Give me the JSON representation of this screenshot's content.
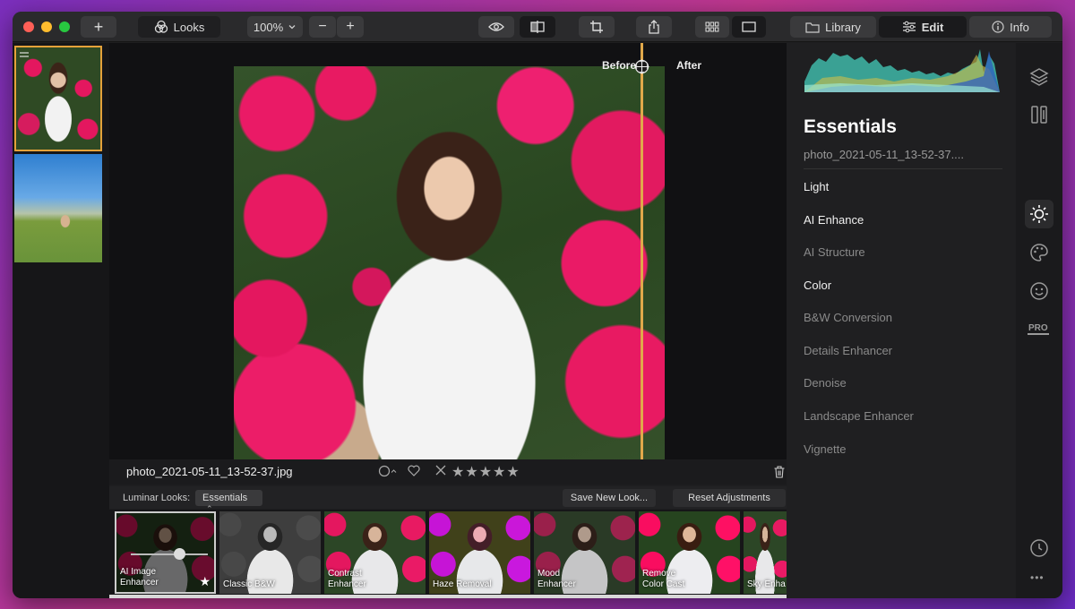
{
  "toolbar": {
    "looks_label": "Looks",
    "zoom": "100%",
    "zoom_out": "−",
    "zoom_in": "+",
    "add": "+",
    "library_label": "Library",
    "edit_label": "Edit",
    "info_label": "Info"
  },
  "canvas": {
    "before_label": "Before",
    "after_label": "After"
  },
  "info_bar": {
    "filename": "photo_2021-05-11_13-52-37.jpg",
    "stars": "★★★★★"
  },
  "looks_bar": {
    "label": "Luminar Looks:",
    "collection": "Essentials",
    "save_new_look": "Save New Look...",
    "reset": "Reset Adjustments"
  },
  "looks": [
    {
      "name": "AI Image Enhancer",
      "line1": "AI Image",
      "line2": "Enhancer"
    },
    {
      "name": "Classic B&W",
      "line1": "Classic B&W",
      "line2": ""
    },
    {
      "name": "Contrast Enhancer",
      "line1": "Contrast",
      "line2": "Enhancer"
    },
    {
      "name": "Haze Removal",
      "line1": "Haze Removal",
      "line2": ""
    },
    {
      "name": "Mood Enhancer",
      "line1": "Mood",
      "line2": "Enhancer"
    },
    {
      "name": "Remove Color Cast",
      "line1": "Remove",
      "line2": "Color Cast"
    },
    {
      "name": "Sky Enhancer",
      "line1": "Sky Enha",
      "line2": ""
    }
  ],
  "panel": {
    "title": "Essentials",
    "filename": "photo_2021-05-11_13-52-37....",
    "tools": [
      {
        "label": "Light",
        "enabled": true
      },
      {
        "label": "AI Enhance",
        "enabled": true
      },
      {
        "label": "AI Structure",
        "enabled": false
      },
      {
        "label": "Color",
        "enabled": true
      },
      {
        "label": "B&W Conversion",
        "enabled": false
      },
      {
        "label": "Details Enhancer",
        "enabled": false
      },
      {
        "label": "Denoise",
        "enabled": false
      },
      {
        "label": "Landscape Enhancer",
        "enabled": false
      },
      {
        "label": "Vignette",
        "enabled": false
      }
    ]
  },
  "rail": {
    "pro_label": "PRO",
    "more": "•••"
  },
  "colors": {
    "accent": "#e0a84a",
    "window_bg": "#1e1e20"
  }
}
